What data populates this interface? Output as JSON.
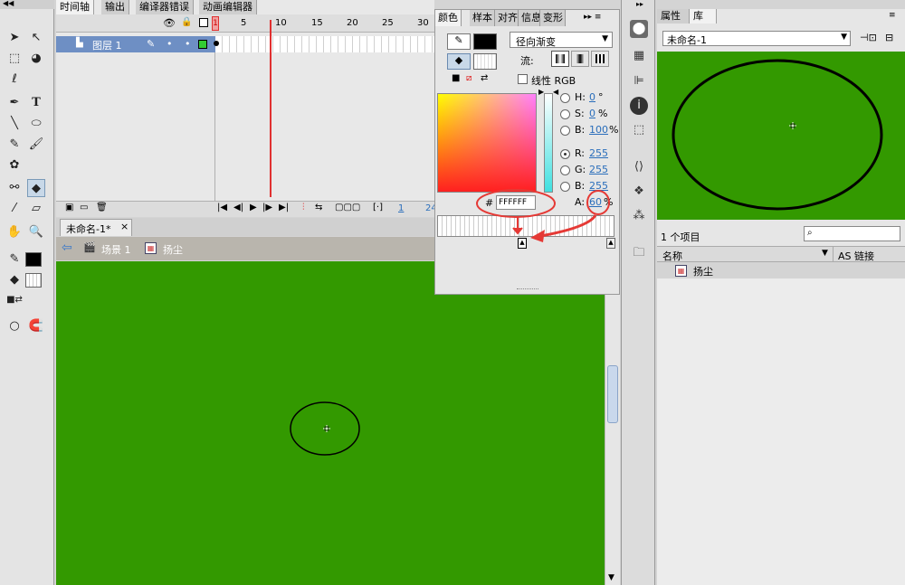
{
  "timeline": {
    "tabs": [
      "时间轴",
      "输出",
      "编译器错误",
      "动画编辑器"
    ],
    "frame_numbers": [
      "1",
      "5",
      "10",
      "15",
      "20",
      "25",
      "30"
    ],
    "layer_name": "图层 1",
    "footer_frame": "1",
    "footer_more": "24"
  },
  "document": {
    "tab_label": "未命名-1*",
    "tab_close": "×",
    "scene_label": "场景 1",
    "symbol_label": "扬尘"
  },
  "color_panel": {
    "tabs": [
      "颜色",
      "样本",
      "对齐",
      "信息",
      "变形"
    ],
    "fill_type": "径向渐变",
    "flow_label": "流:",
    "linear_rgb_label": "线性 RGB",
    "hex_prefix": "#",
    "hex_value": "FFFFFF",
    "hsb": [
      {
        "label": "H:",
        "value": "0",
        "unit": "°"
      },
      {
        "label": "S:",
        "value": "0",
        "unit": "%"
      },
      {
        "label": "B:",
        "value": "100",
        "unit": "%"
      }
    ],
    "rgb": [
      {
        "label": "R:",
        "value": "255"
      },
      {
        "label": "G:",
        "value": "255"
      },
      {
        "label": "B:",
        "value": "255"
      }
    ],
    "alpha_label": "A:",
    "alpha_value": "60",
    "alpha_unit": "%",
    "stroke_color": "#000000",
    "fill_color": "#ffffff"
  },
  "library": {
    "tabs": [
      "属性",
      "库"
    ],
    "doc_select": "未命名-1",
    "item_count": "1 个项目",
    "search_placeholder": "",
    "col_name": "名称",
    "col_link": "AS 链接",
    "items": [
      "扬尘"
    ]
  },
  "colors": {
    "stage_bg": "#339900",
    "accent_red": "#e53935",
    "layer_highlight": "#6e8fc4"
  }
}
